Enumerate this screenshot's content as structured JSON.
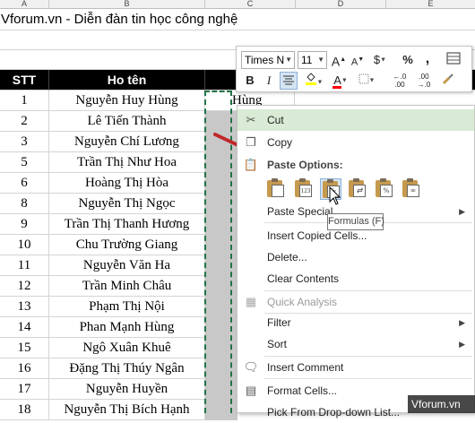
{
  "spreadsheet": {
    "column_letters": [
      "A",
      "B",
      "C",
      "D",
      "E"
    ],
    "title": "Vforum.vn - Diễn đàn tin học công nghệ",
    "headers": {
      "stt": "STT",
      "name": "Ho tên"
    },
    "rows": [
      {
        "stt": "1",
        "name": "Nguyễn Huy Hùng",
        "c": "Hùng"
      },
      {
        "stt": "2",
        "name": "Lê Tiến Thành",
        "c": ""
      },
      {
        "stt": "3",
        "name": "Nguyễn Chí Lương",
        "c": ""
      },
      {
        "stt": "5",
        "name": "Trần Thị Như Hoa",
        "c": ""
      },
      {
        "stt": "6",
        "name": "Hoàng Thị Hòa",
        "c": ""
      },
      {
        "stt": "8",
        "name": "Nguyễn Thị Ngọc",
        "c": ""
      },
      {
        "stt": "9",
        "name": "Trần Thị Thanh Hương",
        "c": ""
      },
      {
        "stt": "10",
        "name": "Chu Trường Giang",
        "c": ""
      },
      {
        "stt": "11",
        "name": "Nguyễn Văn Ha",
        "c": ""
      },
      {
        "stt": "12",
        "name": "Trần Minh Châu",
        "c": ""
      },
      {
        "stt": "13",
        "name": "Phạm Thị Nội",
        "c": ""
      },
      {
        "stt": "14",
        "name": "Phan Mạnh Hùng",
        "c": ""
      },
      {
        "stt": "15",
        "name": "Ngô  Xuân Khuê",
        "c": ""
      },
      {
        "stt": "16",
        "name": "Đặng Thị Thúy Ngân",
        "c": ""
      },
      {
        "stt": "17",
        "name": "Nguyễn Huyền",
        "c": ""
      },
      {
        "stt": "18",
        "name": "Nguyễn Thị Bích Hạnh",
        "c": ""
      }
    ]
  },
  "mini_toolbar": {
    "font_name": "Times N",
    "font_size": "11",
    "font_grow": "A",
    "font_shrink": "A",
    "currency": "$",
    "percent": "%",
    "comma": ",",
    "bold": "B",
    "italic": "I",
    "fill_color": "#ffff00",
    "font_color": "#ff0000",
    "font_color_letter": "A",
    "increase_decimal": "←.0\n.00",
    "decrease_decimal": ".00\n→.0"
  },
  "context_menu": {
    "cut": "Cut",
    "copy": "Copy",
    "paste_options_header": "Paste Options:",
    "paste_values_badge": "123",
    "paste_formulas_badge": "fx",
    "paste_percent_badge": "%",
    "paste_special": "Paste Special...",
    "insert_copied_cells": "Insert Copied Cells...",
    "delete": "Delete...",
    "clear_contents": "Clear Contents",
    "quick_analysis": "Quick Analysis",
    "filter": "Filter",
    "sort": "Sort",
    "insert_comment": "Insert Comment",
    "format_cells": "Format Cells...",
    "pick_from_dropdown": "Pick From Drop-down List..."
  },
  "tooltip": "Formulas (F)",
  "watermark": "Vforum.vn",
  "colors": {
    "accent_green": "#217346",
    "highlight": "#d9ead5",
    "arrow_red": "#c0282a"
  },
  "icons": [
    "scissors-icon",
    "copy-icon",
    "paste-icon",
    "paste-values-icon",
    "paste-formulas-icon",
    "paste-transpose-icon",
    "paste-percent-icon",
    "paste-link-icon",
    "quick-analysis-icon",
    "comment-icon",
    "format-cells-icon",
    "mouse-cursor-icon"
  ]
}
